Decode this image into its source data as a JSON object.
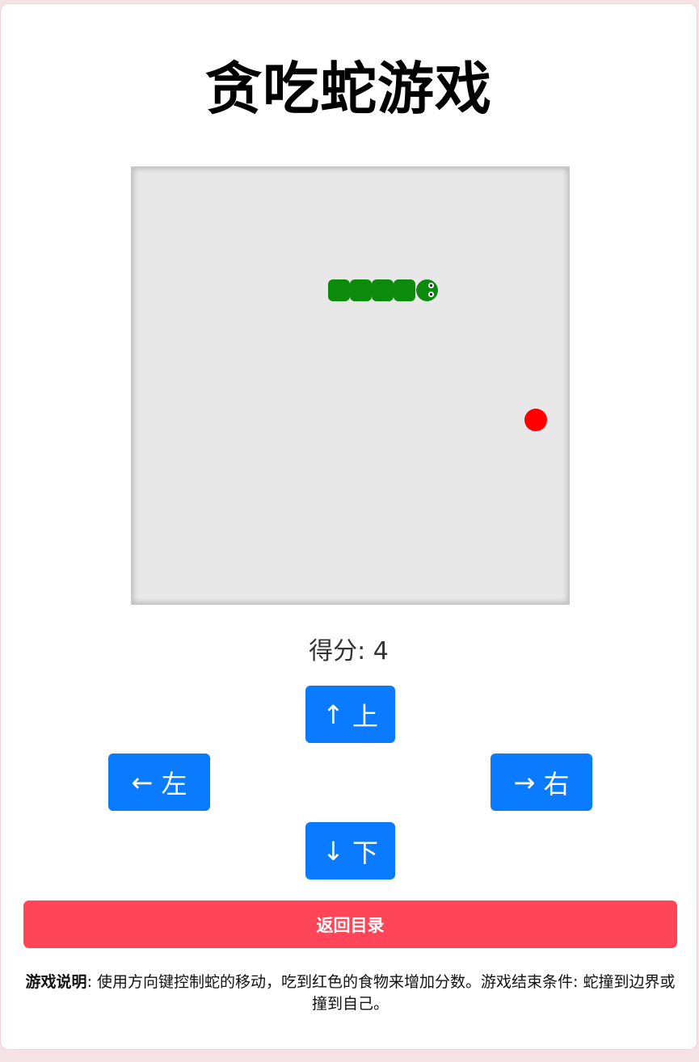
{
  "title": "贪吃蛇游戏",
  "score": {
    "label": "得分:",
    "value": "4"
  },
  "controls": {
    "up": {
      "arrow": "↑",
      "label": "上"
    },
    "left": {
      "arrow": "←",
      "label": "左"
    },
    "right": {
      "arrow": "→",
      "label": "右"
    },
    "down": {
      "arrow": "↓",
      "label": "下"
    }
  },
  "back_button": "返回目录",
  "instructions": {
    "heading": "游戏说明",
    "text": ": 使用方向键控制蛇的移动，吃到红色的食物来增加分数。游戏结束条件: 蛇撞到边界或撞到自己。"
  },
  "game": {
    "snake_length": 5,
    "snake_color": "#0b8a0b",
    "food_color": "#ff0000",
    "board_color": "#e8e8e8"
  },
  "colors": {
    "control_button": "#0a7bff",
    "back_button": "#ff4557"
  }
}
